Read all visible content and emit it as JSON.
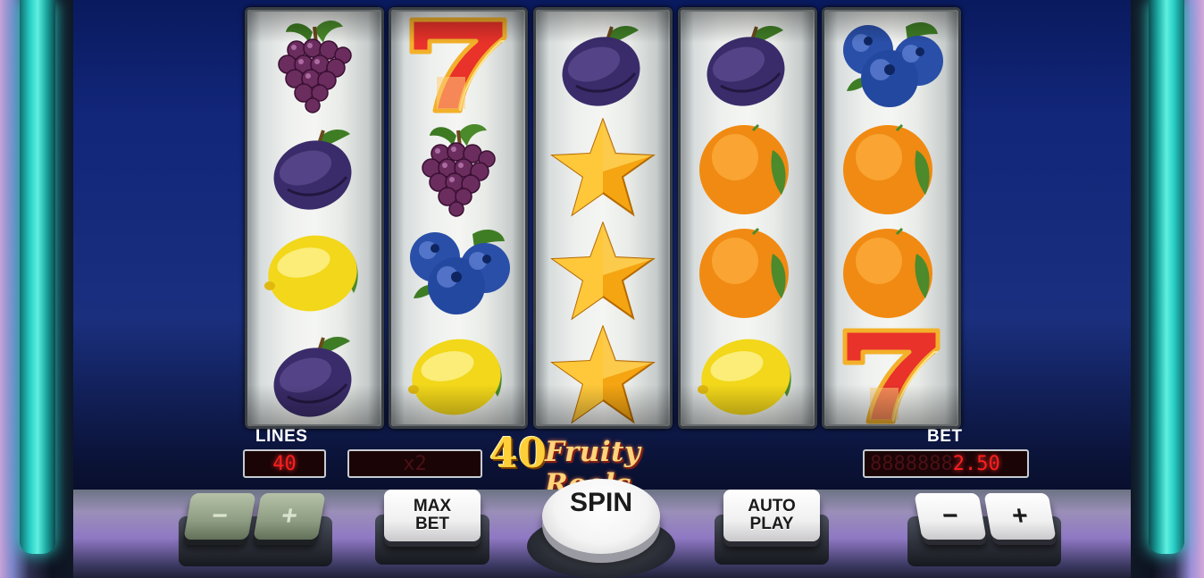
{
  "game": {
    "logo_number": "40",
    "logo_word": "Fruity Reels"
  },
  "panel": {
    "lines_label": "LINES",
    "lines_value": "40",
    "multiplier_value": "x2",
    "bet_label": "BET",
    "bet_ghost": "8888888",
    "bet_value": "2.50"
  },
  "buttons": {
    "lines_minus": "−",
    "lines_plus": "+",
    "max_bet_line1": "MAX",
    "max_bet_line2": "BET",
    "spin": "SPIN",
    "auto_play_line1": "AUTO",
    "auto_play_line2": "PLAY",
    "bet_minus": "−",
    "bet_plus": "+"
  },
  "reels": [
    {
      "symbols": [
        "grapes",
        "plum",
        "lemon",
        "plum"
      ]
    },
    {
      "symbols": [
        "seven",
        "grapes",
        "blueberries",
        "lemon"
      ]
    },
    {
      "symbols": [
        "plum",
        "star",
        "star",
        "star"
      ]
    },
    {
      "symbols": [
        "plum",
        "orange",
        "orange",
        "lemon"
      ]
    },
    {
      "symbols": [
        "blueberries",
        "orange",
        "orange",
        "seven"
      ]
    }
  ],
  "colors": {
    "lcd_red": "#ff1e1e",
    "neon_teal": "#2ad0c8",
    "logo_gold": "#ffcf3a"
  }
}
